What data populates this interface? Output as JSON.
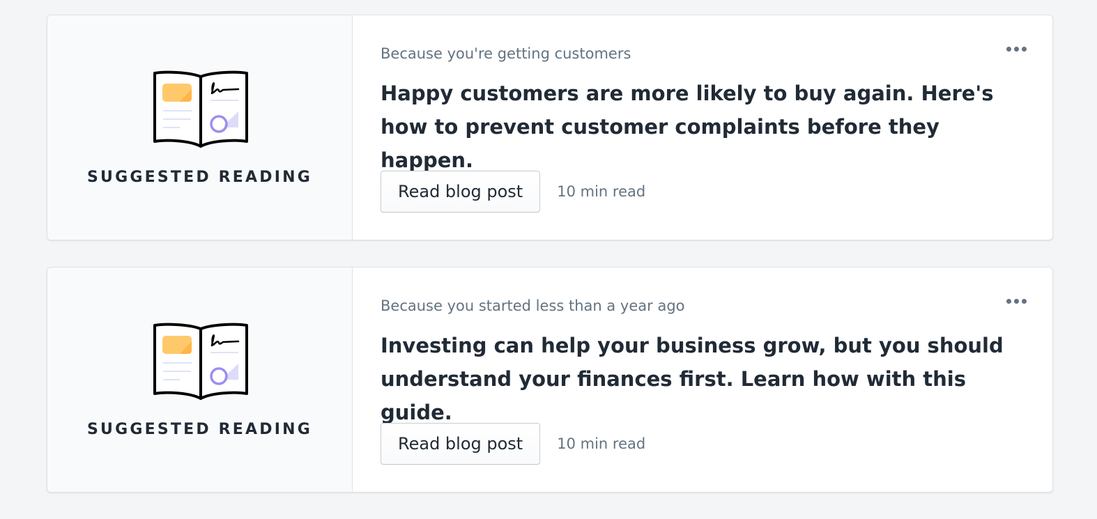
{
  "cards": [
    {
      "aside_title": "SUGGESTED READING",
      "illustration_icon": "open-book-icon",
      "reason": "Because you're getting customers",
      "headline": "Happy customers are more likely to buy again. Here's how to prevent customer complaints before they happen.",
      "button_label": "Read blog post",
      "read_time": "10 min read",
      "menu_icon": "more-horizontal-icon"
    },
    {
      "aside_title": "SUGGESTED READING",
      "illustration_icon": "open-book-icon",
      "reason": "Because you started less than a year ago",
      "headline": "Investing can help your business grow, but you should understand your finances first. Learn how with this guide.",
      "button_label": "Read blog post",
      "read_time": "10 min read",
      "menu_icon": "more-horizontal-icon"
    }
  ],
  "colors": {
    "page_background": "#f4f5f7",
    "card_background": "#ffffff",
    "aside_background": "#f9fafb",
    "text_primary": "#212b36",
    "text_subdued": "#637381",
    "illustration_yellow": "#ffc96b",
    "illustration_purple": "#9c8ff0"
  }
}
